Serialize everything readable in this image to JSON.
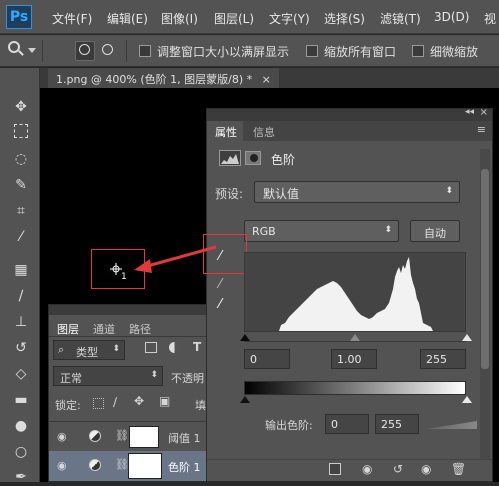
{
  "app": {
    "logo": "Ps"
  },
  "menu": [
    "文件(F)",
    "编辑(E)",
    "图像(I)",
    "图层(L)",
    "文字(Y)",
    "选择(S)",
    "滤镜(T)",
    "3D(D)",
    "视"
  ],
  "options": {
    "resize_windows": "调整窗口大小以满屏显示",
    "zoom_all": "缩放所有窗口",
    "scrubby_zoom": "细微缩放"
  },
  "document": {
    "tab_title": "1.png @ 400% (色阶 1, 图层蒙版/8) *",
    "close": "×"
  },
  "properties": {
    "tabs": [
      "属性",
      "信息"
    ],
    "adjustment_name": "色阶",
    "preset_label": "预设:",
    "preset_value": "默认值",
    "channel_value": "RGB",
    "auto_label": "自动",
    "input_black": "0",
    "input_gamma": "1.00",
    "input_white": "255",
    "output_label": "输出色阶:",
    "output_black": "0",
    "output_white": "255"
  },
  "layers": {
    "tabs": [
      "图层",
      "通道",
      "路径"
    ],
    "filter_kind": "类型",
    "blend_mode": "正常",
    "opacity_label": "不透明",
    "lock_label": "锁定:",
    "fill_label": "填",
    "items": [
      {
        "name": "阈值 1"
      },
      {
        "name": "色阶 1"
      }
    ]
  },
  "colors": {
    "annotation_red": "#e03a3a",
    "panel_bg": "#535353",
    "canvas_bg": "#000000",
    "accent_blue": "#31a8ff"
  }
}
